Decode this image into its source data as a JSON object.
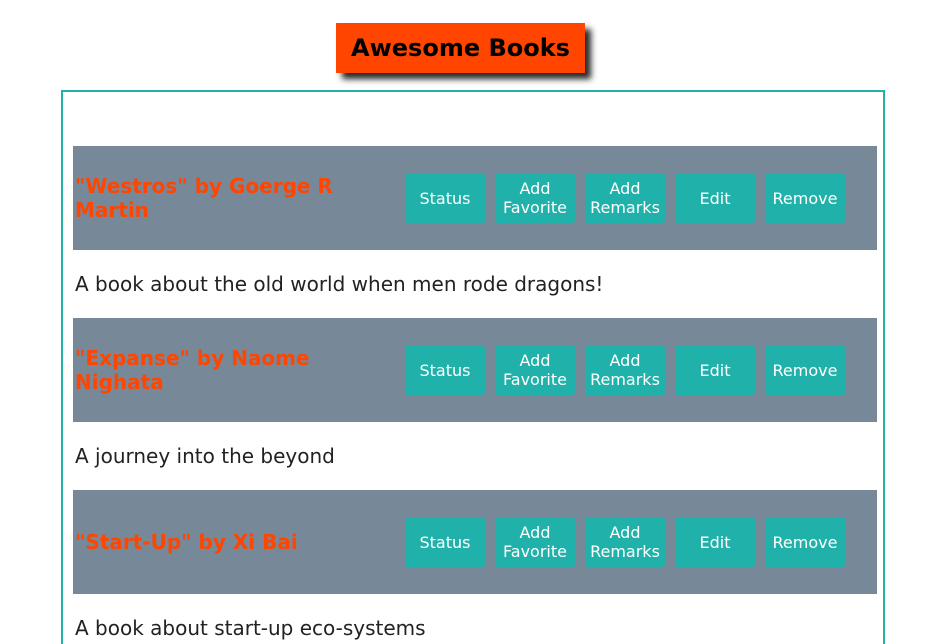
{
  "app": {
    "title": "Awesome Books"
  },
  "buttons": {
    "status": "Status",
    "favorite": "Add\nFavorite",
    "remarks": "Add\nRemarks",
    "edit": "Edit",
    "remove": "Remove"
  },
  "books": [
    {
      "heading": "\"Westros\" by Goerge R Martin",
      "description": "A book about the old world when men rode dragons!"
    },
    {
      "heading": "\"Expanse\" by Naome Nighata",
      "description": "A journey into the beyond"
    },
    {
      "heading": "\"Start-Up\" by Xi Bai",
      "description": "A book about start-up eco-systems"
    }
  ],
  "colors": {
    "title_bg": "#ff4500",
    "container_border": "#20b2aa",
    "header_bg": "#778899",
    "button_bg": "#20b2aa",
    "book_title": "#ff4500"
  }
}
